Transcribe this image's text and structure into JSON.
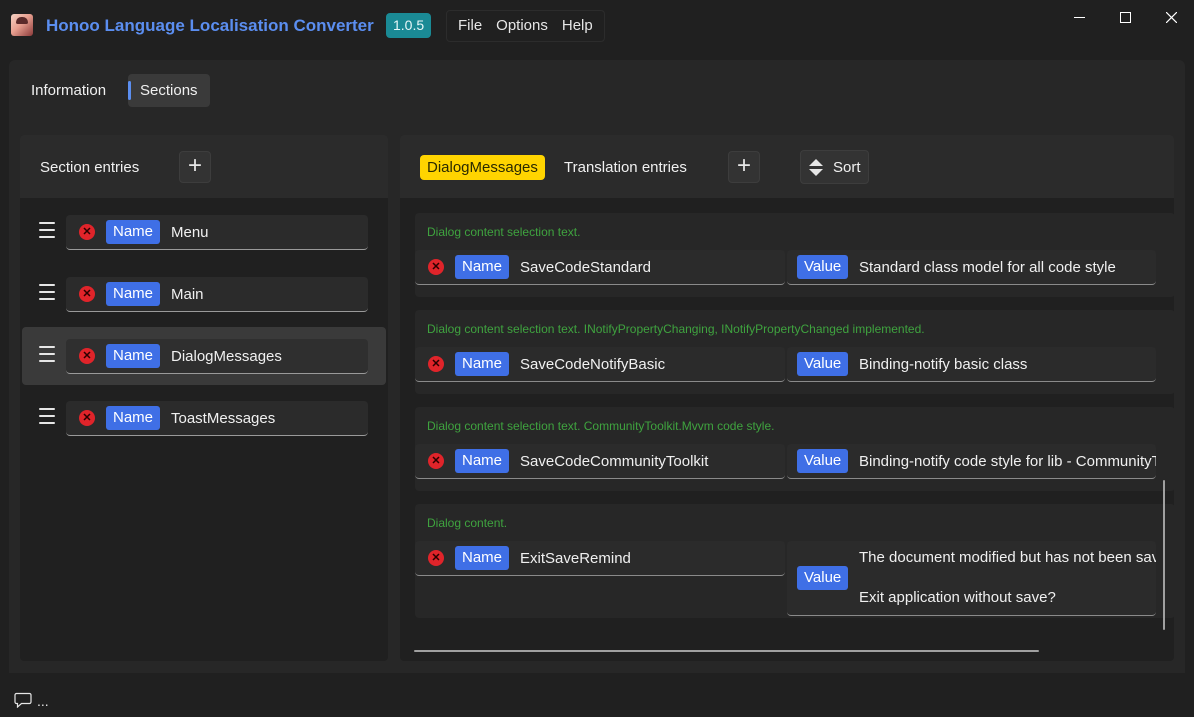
{
  "app": {
    "title": "Honoo Language Localisation Converter",
    "version": "1.0.5"
  },
  "menu": [
    "File",
    "Options",
    "Help"
  ],
  "window_controls": {
    "minimize": "—",
    "maximize": "☐",
    "close": "✕"
  },
  "tabs": [
    {
      "label": "Information",
      "selected": false
    },
    {
      "label": "Sections",
      "selected": true
    }
  ],
  "left_panel": {
    "title": "Section entries",
    "add_label": "+",
    "name_badge": "Name",
    "sections": [
      {
        "name": "Menu",
        "selected": false
      },
      {
        "name": "Main",
        "selected": false
      },
      {
        "name": "DialogMessages",
        "selected": true
      },
      {
        "name": "ToastMessages",
        "selected": false
      }
    ]
  },
  "right_panel": {
    "section_badge": "DialogMessages",
    "title": "Translation entries",
    "add_label": "+",
    "sort_label": "Sort",
    "name_badge": "Name",
    "value_badge": "Value",
    "entries": [
      {
        "comment": "Dialog content selection text.",
        "name": "SaveCodeStandard",
        "value": "Standard class model for all code style"
      },
      {
        "comment": "Dialog content selection text. INotifyPropertyChanging, INotifyPropertyChanged implemented.",
        "name": "SaveCodeNotifyBasic",
        "value": "Binding-notify basic class"
      },
      {
        "comment": "Dialog content selection text. CommunityToolkit.Mvvm code style.",
        "name": "SaveCodeCommunityToolkit",
        "value": "Binding-notify code style for lib - CommunityToolkit.Mvvm"
      },
      {
        "comment": "Dialog content.",
        "name": "ExitSaveRemind",
        "value_line1": "The document modified but has not been saved.",
        "value_line2": "Exit application without save?"
      }
    ]
  },
  "status": {
    "text": "..."
  },
  "colors": {
    "accent": "#5b8ef0",
    "badge_blue": "#3f6fe6",
    "section_yellow": "#ffd400",
    "version_teal": "#1a8a95",
    "delete_red": "#e0242a",
    "comment_green": "#3fa33f"
  }
}
